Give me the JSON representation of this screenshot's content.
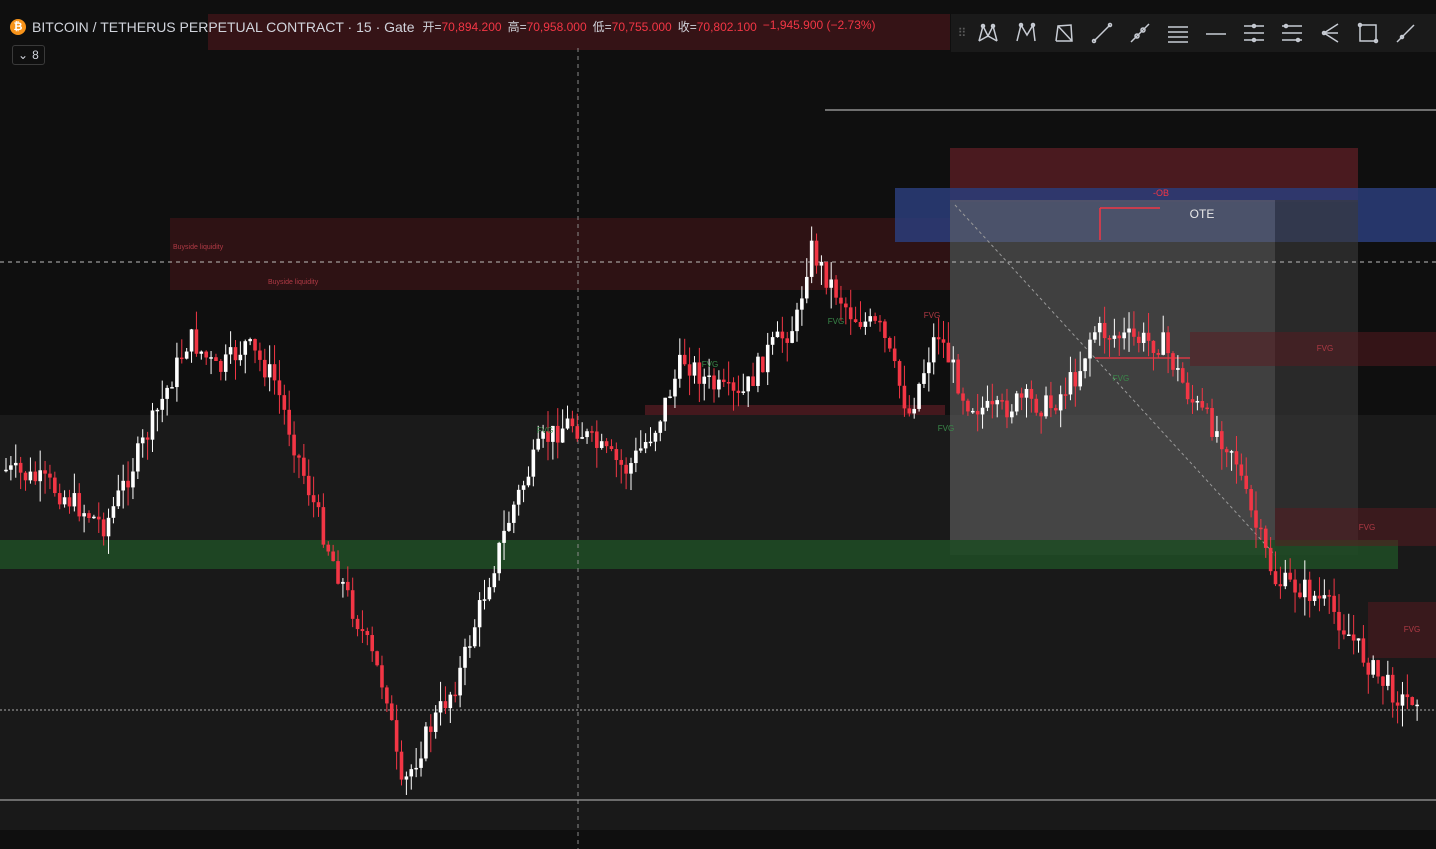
{
  "header": {
    "coin_glyph": "₿",
    "title": "BITCOIN / TETHERUS PERPETUAL CONTRACT · 15 · Gate",
    "ohlc": [
      {
        "k": "开=",
        "v": "70,894.200"
      },
      {
        "k": "高=",
        "v": "70,958.000"
      },
      {
        "k": "低=",
        "v": "70,755.000"
      },
      {
        "k": "收=",
        "v": "70,802.100"
      },
      {
        "k": "",
        "v": "−1,945.900 (−2.73%)"
      }
    ],
    "collapse_label": "8"
  },
  "toolbar": {
    "icons": [
      "xabcd-pattern-icon",
      "cypher-pattern-icon",
      "abcd-pattern-icon",
      "trend-line-icon",
      "ray-icon",
      "horizontal-lines-icon",
      "horizontal-line-icon",
      "parallel-channel-icon",
      "pitchfork-icon",
      "fib-retracement-icon",
      "rectangle-icon",
      "brush-icon"
    ]
  },
  "chart_data": {
    "type": "candlestick",
    "symbol": "BITCOIN / TETHERUS PERPETUAL CONTRACT",
    "timeframe": "15",
    "exchange": "Gate",
    "last_bar": {
      "open": 70894.2,
      "high": 70958.0,
      "low": 70755.0,
      "close": 70802.1,
      "change": -1945.9,
      "change_pct": -2.73
    },
    "annotations": [
      "Buyside liquidity",
      "Buyside liquidity",
      "OTE",
      "-OB",
      "FVG"
    ],
    "colors": {
      "up": "#ffffff",
      "down": "#f23645",
      "bg": "#0f0f0f",
      "ote": "#2a3d7a",
      "fvg_bear": "#5a1a20",
      "fvg_bull": "#1f4a25"
    },
    "price_path": [
      [
        0,
        0.5
      ],
      [
        0.03,
        0.52
      ],
      [
        0.07,
        0.58
      ],
      [
        0.1,
        0.45
      ],
      [
        0.13,
        0.31
      ],
      [
        0.15,
        0.36
      ],
      [
        0.17,
        0.32
      ],
      [
        0.19,
        0.37
      ],
      [
        0.21,
        0.5
      ],
      [
        0.23,
        0.62
      ],
      [
        0.25,
        0.72
      ],
      [
        0.27,
        0.82
      ],
      [
        0.28,
        0.96
      ],
      [
        0.3,
        0.87
      ],
      [
        0.32,
        0.8
      ],
      [
        0.34,
        0.67
      ],
      [
        0.36,
        0.55
      ],
      [
        0.38,
        0.46
      ],
      [
        0.4,
        0.43
      ],
      [
        0.42,
        0.47
      ],
      [
        0.44,
        0.5
      ],
      [
        0.46,
        0.44
      ],
      [
        0.48,
        0.34
      ],
      [
        0.5,
        0.38
      ],
      [
        0.52,
        0.4
      ],
      [
        0.54,
        0.33
      ],
      [
        0.56,
        0.29
      ],
      [
        0.57,
        0.18
      ],
      [
        0.58,
        0.22
      ],
      [
        0.6,
        0.28
      ],
      [
        0.62,
        0.3
      ],
      [
        0.64,
        0.42
      ],
      [
        0.66,
        0.3
      ],
      [
        0.68,
        0.4
      ],
      [
        0.7,
        0.42
      ],
      [
        0.72,
        0.4
      ],
      [
        0.74,
        0.41
      ],
      [
        0.76,
        0.36
      ],
      [
        0.77,
        0.3
      ],
      [
        0.79,
        0.31
      ],
      [
        0.82,
        0.32
      ],
      [
        0.84,
        0.4
      ],
      [
        0.86,
        0.45
      ],
      [
        0.87,
        0.47
      ],
      [
        0.88,
        0.55
      ],
      [
        0.9,
        0.66
      ],
      [
        0.92,
        0.67
      ],
      [
        0.94,
        0.7
      ],
      [
        0.95,
        0.73
      ],
      [
        0.97,
        0.79
      ],
      [
        0.99,
        0.83
      ],
      [
        1.0,
        0.82
      ]
    ]
  },
  "labels": {
    "ote": "OTE",
    "ob": "-OB",
    "fvg": "FVG",
    "liq1": "Buyside liquidity",
    "liq2": "Buyside liquidity"
  }
}
